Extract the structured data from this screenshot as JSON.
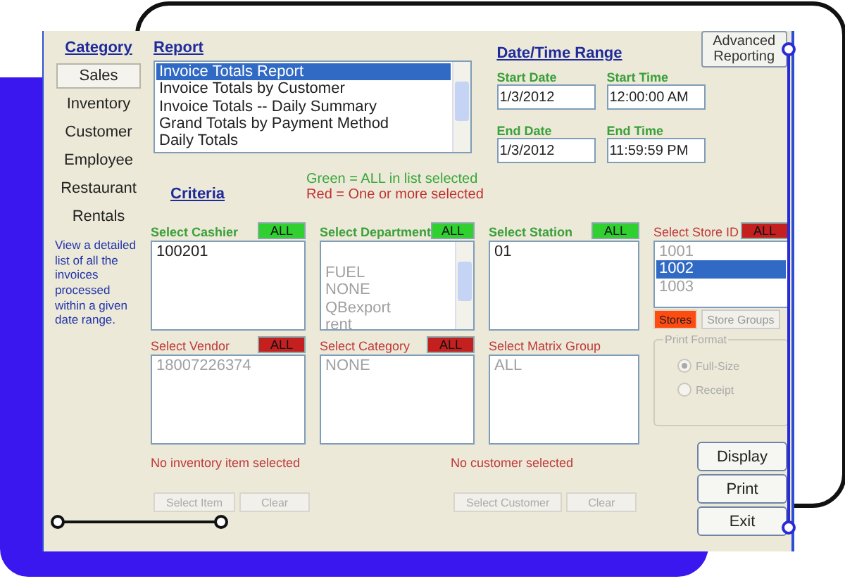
{
  "category": {
    "title": "Category",
    "items": [
      {
        "label": "Sales",
        "selected": true
      },
      {
        "label": "Inventory",
        "selected": false
      },
      {
        "label": "Customer",
        "selected": false
      },
      {
        "label": "Employee",
        "selected": false
      },
      {
        "label": "Restaurant",
        "selected": false
      },
      {
        "label": "Rentals",
        "selected": false
      }
    ],
    "description": "View a detailed list of all the invoices processed within a given date range."
  },
  "report": {
    "title": "Report",
    "scrollbar": true,
    "items": [
      {
        "label": "Invoice Totals Report",
        "selected": true
      },
      {
        "label": "Invoice Totals by Customer",
        "selected": false
      },
      {
        "label": "Invoice Totals -- Daily Summary",
        "selected": false
      },
      {
        "label": "Grand Totals by Payment Method",
        "selected": false
      },
      {
        "label": "Daily Totals",
        "selected": false
      }
    ]
  },
  "date_time": {
    "title": "Date/Time Range",
    "fields": [
      {
        "label": "Start Date",
        "value": "1/3/2012"
      },
      {
        "label": "Start Time",
        "value": "12:00:00 AM"
      },
      {
        "label": "End Date",
        "value": "1/3/2012"
      },
      {
        "label": "End Time",
        "value": "11:59:59 PM"
      }
    ]
  },
  "advanced_button": "Advanced Reporting",
  "criteria": {
    "title": "Criteria",
    "legend": [
      {
        "text": "Green = ALL in list selected",
        "color": "#3aa63a"
      },
      {
        "text": "Red = One or more selected",
        "color": "#c03030"
      }
    ]
  },
  "selectors": [
    {
      "label": "Select Cashier",
      "all_button": "ALL",
      "all_selected": true,
      "greyed": false,
      "scrollbar": false,
      "items": [
        {
          "text": "100201",
          "selected": false
        }
      ]
    },
    {
      "label": "Select Department",
      "all_button": "ALL",
      "all_selected": true,
      "greyed": true,
      "scrollbar": true,
      "items": [
        {
          "text": "FUEL",
          "selected": false
        },
        {
          "text": "NONE",
          "selected": false
        },
        {
          "text": "QBexport",
          "selected": false
        },
        {
          "text": "rent",
          "selected": false
        }
      ]
    },
    {
      "label": "Select Station",
      "all_button": "ALL",
      "all_selected": true,
      "greyed": false,
      "scrollbar": false,
      "items": [
        {
          "text": "01",
          "selected": false
        }
      ]
    },
    {
      "label": "Select Store ID",
      "all_button": "ALL",
      "all_selected": false,
      "greyed": true,
      "scrollbar": false,
      "items": [
        {
          "text": "1001",
          "selected": false
        },
        {
          "text": "1002",
          "selected": true
        },
        {
          "text": "1003",
          "selected": false
        }
      ],
      "toggles": [
        {
          "label": "Stores",
          "selected": true
        },
        {
          "label": "Store Groups",
          "selected": false
        }
      ]
    },
    {
      "label": "Select Vendor",
      "all_button": "ALL",
      "all_selected": false,
      "greyed": true,
      "scrollbar": false,
      "items": [
        {
          "text": "18007226374",
          "selected": false
        }
      ]
    },
    {
      "label": "Select Category",
      "all_button": "ALL",
      "all_selected": false,
      "greyed": true,
      "scrollbar": false,
      "items": [
        {
          "text": "NONE",
          "selected": false
        }
      ]
    },
    {
      "label": "Select Matrix Group",
      "all_selected": false,
      "greyed": true,
      "scrollbar": false,
      "items": [
        {
          "text": "ALL",
          "selected": false
        }
      ]
    }
  ],
  "print_format": {
    "title": "Print Format",
    "disabled": true,
    "options": [
      {
        "label": "Full-Size",
        "selected": true
      },
      {
        "label": "Receipt",
        "selected": false
      }
    ]
  },
  "pickers": [
    {
      "note": "No inventory item selected",
      "buttons": [
        {
          "label": "Select Item",
          "disabled": true
        },
        {
          "label": "Clear",
          "disabled": true
        }
      ]
    },
    {
      "note": "No customer selected",
      "buttons": [
        {
          "label": "Select Customer",
          "disabled": true
        },
        {
          "label": "Clear",
          "disabled": true
        }
      ]
    }
  ],
  "actions": [
    {
      "label": "Display"
    },
    {
      "label": "Print"
    },
    {
      "label": "Exit"
    }
  ]
}
